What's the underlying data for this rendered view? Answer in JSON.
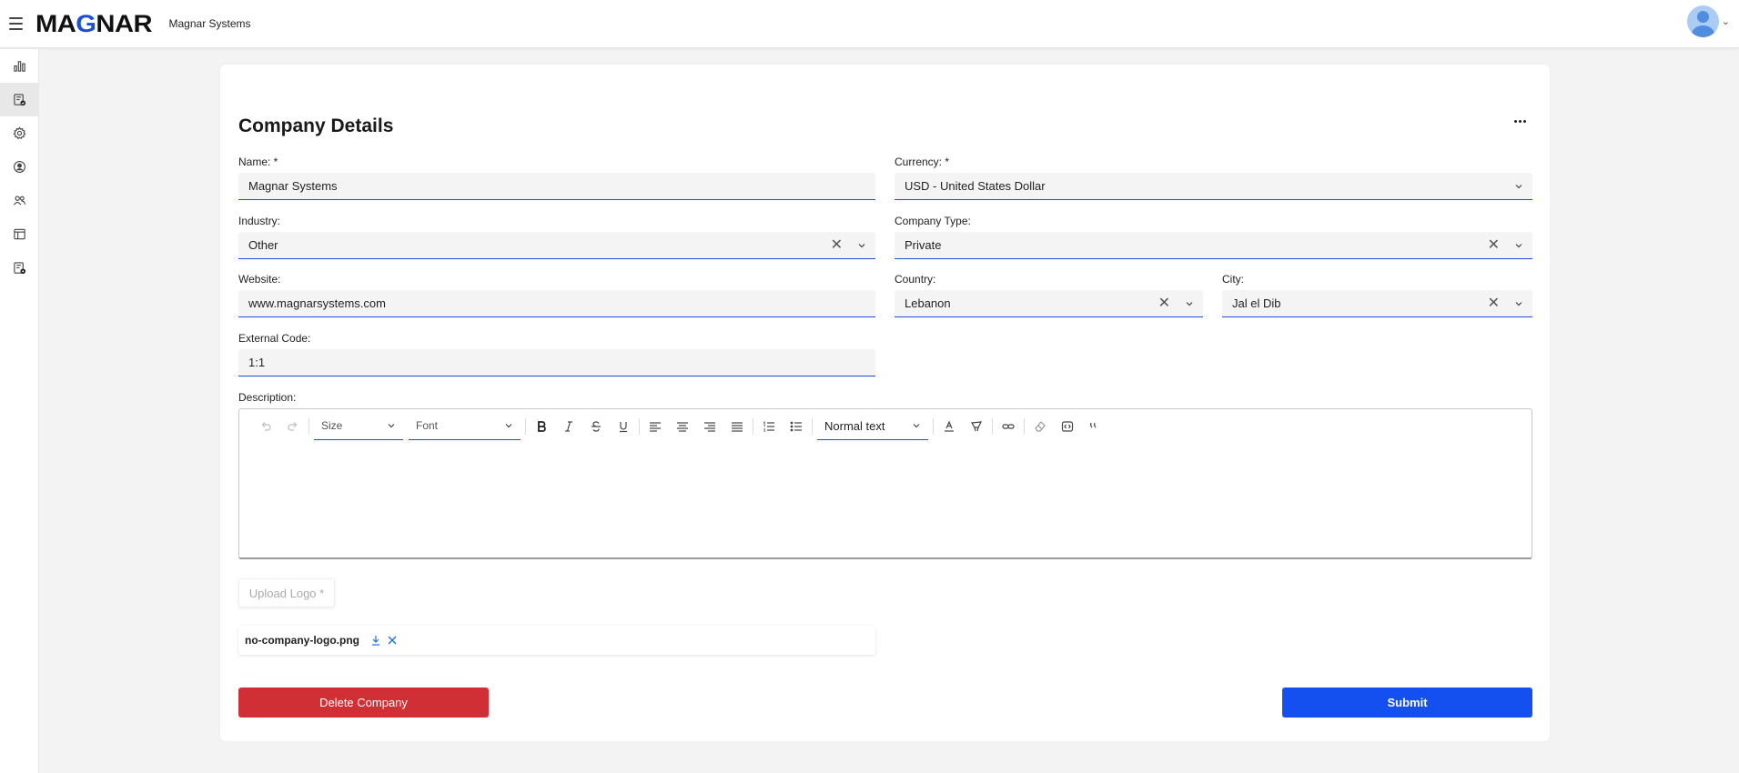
{
  "header": {
    "logo_left": "MA",
    "logo_accent": "G",
    "logo_right": "NAR",
    "app_title": "Magnar Systems"
  },
  "sidebar": {
    "items": [
      {
        "icon": "bar-chart-icon"
      },
      {
        "icon": "document-check-icon",
        "active": true
      },
      {
        "icon": "gear-icon"
      },
      {
        "icon": "user-circle-icon"
      },
      {
        "icon": "users-icon"
      },
      {
        "icon": "layout-icon"
      },
      {
        "icon": "document-settings-icon"
      }
    ]
  },
  "form": {
    "title": "Company Details",
    "name": {
      "label": "Name: *",
      "value": "Magnar Systems"
    },
    "currency": {
      "label": "Currency: *",
      "value": "USD - United States Dollar"
    },
    "industry": {
      "label": "Industry:",
      "value": "Other"
    },
    "company_type": {
      "label": "Company Type:",
      "value": "Private"
    },
    "website": {
      "label": "Website:",
      "value": "www.magnarsystems.com"
    },
    "country": {
      "label": "Country:",
      "value": "Lebanon"
    },
    "city": {
      "label": "City:",
      "value": "Jal el Dib"
    },
    "external_code": {
      "label": "External Code:",
      "value": "1:1"
    },
    "description": {
      "label": "Description:"
    }
  },
  "editor": {
    "size_placeholder": "Size",
    "font_placeholder": "Font",
    "block_format": "Normal text"
  },
  "upload": {
    "button_label": "Upload Logo *",
    "file_name": "no-company-logo.png"
  },
  "actions": {
    "delete_label": "Delete Company",
    "submit_label": "Submit"
  },
  "colors": {
    "accent": "#1b4fd8",
    "delete": "#d03035",
    "submit": "#1450f0"
  }
}
